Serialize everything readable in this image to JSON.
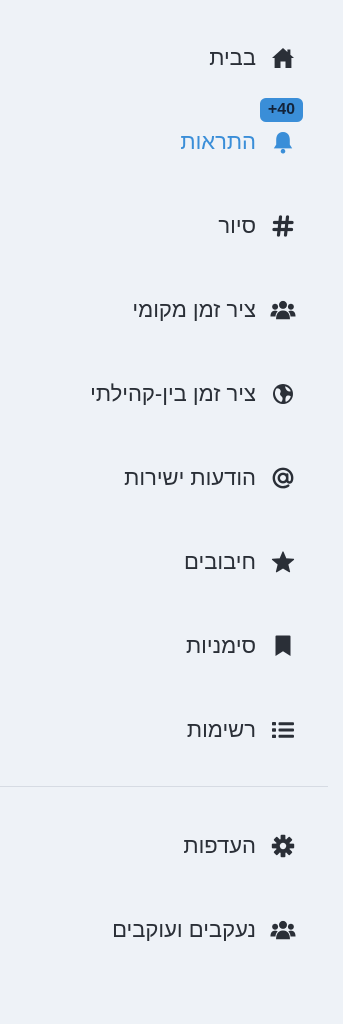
{
  "nav": {
    "items": [
      {
        "label": "בבית",
        "icon": "home-icon"
      },
      {
        "label": "התראות",
        "icon": "bell-icon",
        "badge": "+40",
        "active": true,
        "active_color": "#3a8ed8"
      },
      {
        "label": "סיור",
        "icon": "hashtag-icon"
      },
      {
        "label": "ציר זמן מקומי",
        "icon": "users-icon"
      },
      {
        "label": "ציר זמן בין-קהילתי",
        "icon": "globe-icon"
      },
      {
        "label": "הודעות ישירות",
        "icon": "at-sign-icon"
      },
      {
        "label": "חיבובים",
        "icon": "star-icon"
      },
      {
        "label": "סימניות",
        "icon": "bookmark-icon"
      },
      {
        "label": "רשימות",
        "icon": "list-icon"
      }
    ],
    "secondary_items": [
      {
        "label": "העדפות",
        "icon": "gear-icon"
      },
      {
        "label": "נעקבים ועוקבים",
        "icon": "users-icon"
      }
    ]
  },
  "colors": {
    "background": "#eef2f7",
    "text": "#2a2f37",
    "accent": "#3a8ed8",
    "divider": "#d6dbe3"
  }
}
